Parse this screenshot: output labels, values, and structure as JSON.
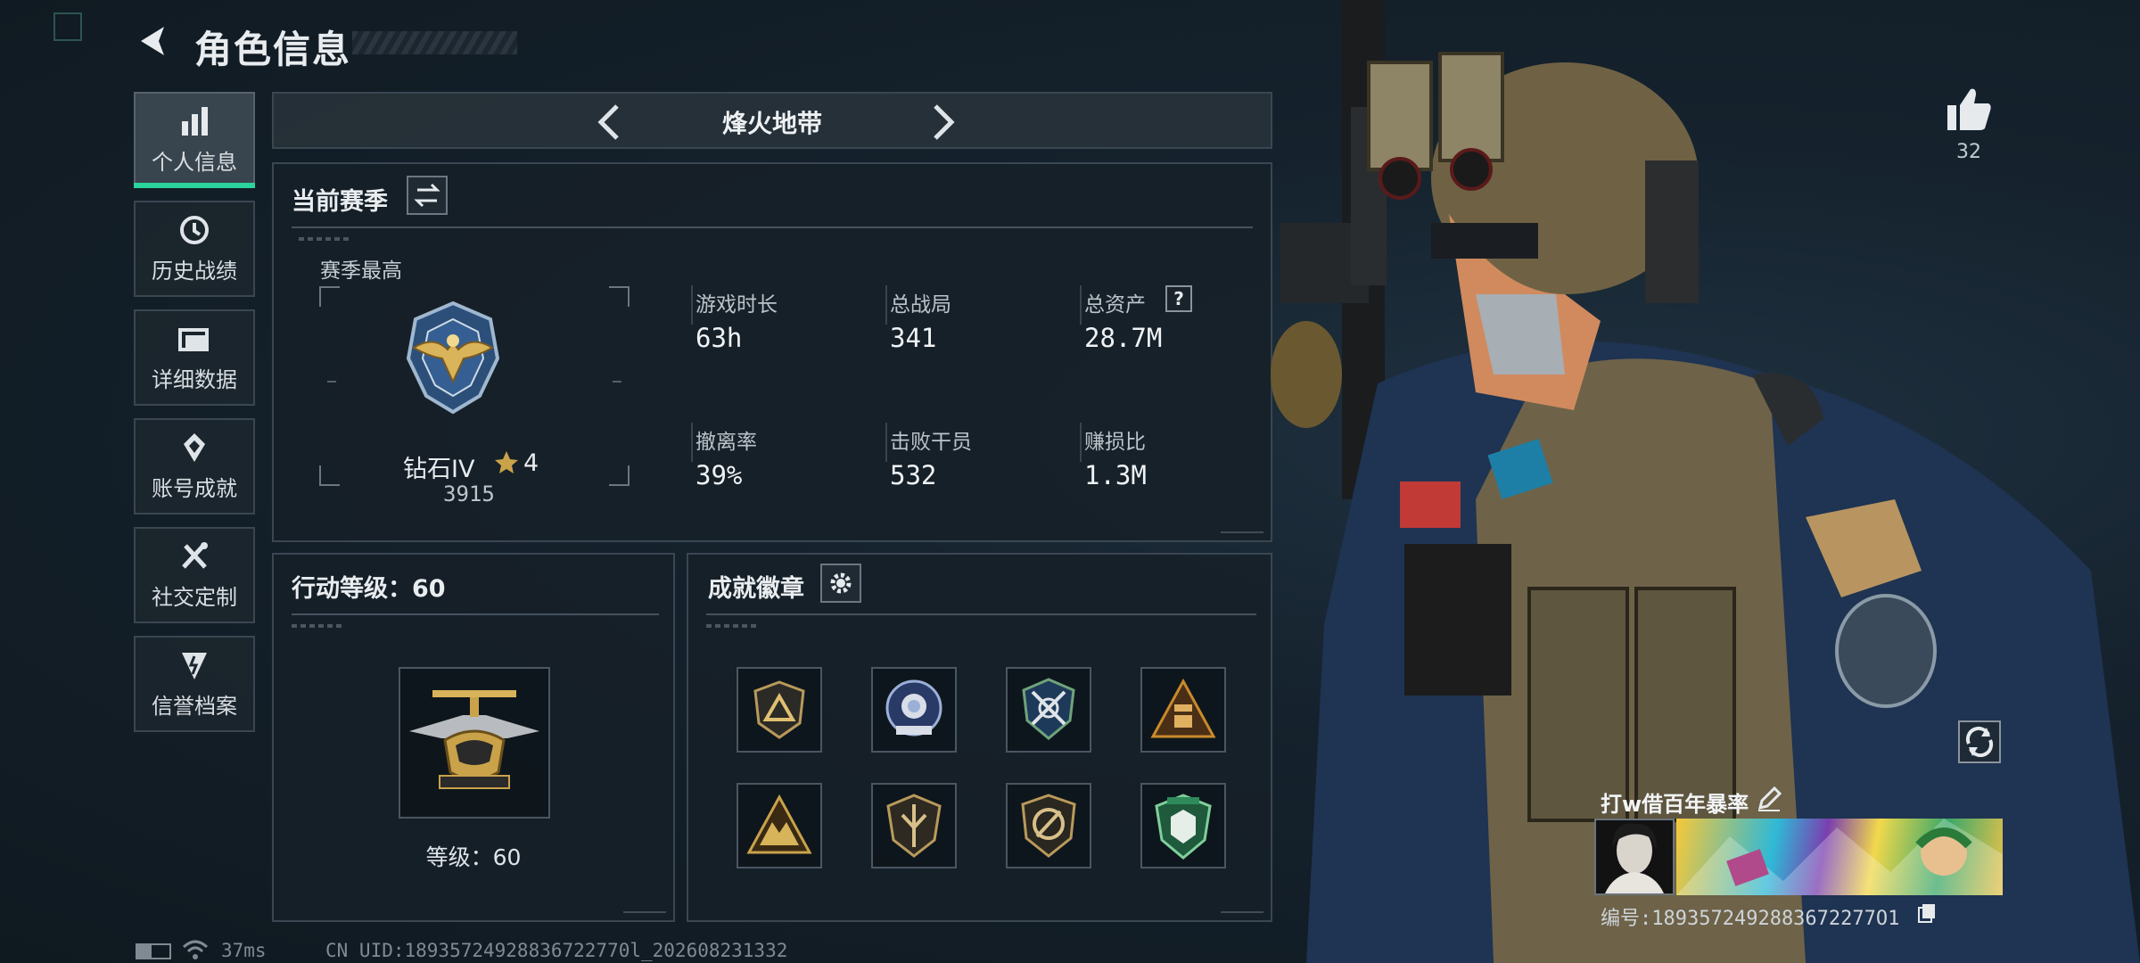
{
  "header": {
    "title": "角色信息"
  },
  "sidebar": {
    "items": [
      {
        "label": "个人信息",
        "icon": "bar-chart-icon",
        "active": true
      },
      {
        "label": "历史战绩",
        "icon": "history-icon",
        "active": false
      },
      {
        "label": "详细数据",
        "icon": "folder-icon",
        "active": false
      },
      {
        "label": "账号成就",
        "icon": "achievement-icon",
        "active": false
      },
      {
        "label": "社交定制",
        "icon": "wrench-icon",
        "active": false
      },
      {
        "label": "信誉档案",
        "icon": "credit-icon",
        "active": false
      }
    ]
  },
  "mode": {
    "title": "烽火地带"
  },
  "season": {
    "title": "当前赛季",
    "best_label": "赛季最高",
    "rank_name": "钻石IV",
    "rank_stars": "4",
    "rank_score": "3915",
    "stats": [
      {
        "label": "游戏时长",
        "value": "63h"
      },
      {
        "label": "总战局",
        "value": "341"
      },
      {
        "label": "总资产",
        "value": "28.7M",
        "has_help": true
      },
      {
        "label": "撤离率",
        "value": "39%"
      },
      {
        "label": "击败干员",
        "value": "532"
      },
      {
        "label": "赚损比",
        "value": "1.3M"
      }
    ],
    "help_glyph": "?"
  },
  "level": {
    "title": "行动等级：60",
    "level_text": "等级：60"
  },
  "badges": {
    "title": "成就徽章",
    "items": [
      {
        "name": "triangle-shield-badge",
        "color": "#c9a24a"
      },
      {
        "name": "rose-emblem-badge",
        "color": "#9bb0d6"
      },
      {
        "name": "crossed-rifles-badge",
        "color": "#4a7fb0"
      },
      {
        "name": "ammo-crate-badge",
        "color": "#c98a2a"
      },
      {
        "name": "mountain-triangle-badge",
        "color": "#c9a24a"
      },
      {
        "name": "arrow-shield-badge",
        "color": "#b89a5a"
      },
      {
        "name": "round-shield-badge",
        "color": "#b89a5a"
      },
      {
        "name": "green-crest-badge",
        "color": "#2e8a5a"
      }
    ]
  },
  "profile": {
    "likes": "32",
    "player_name": "打w借百年暴率",
    "player_id": "编号:1893572492883672277O1"
  },
  "status_bar": {
    "ping": "37ms",
    "uid": "CN UID:18935724928836722770l_202608231332"
  },
  "colors": {
    "accent": "#2bd49c",
    "panel_border": "#3a4651",
    "gold": "#c9a24a"
  }
}
